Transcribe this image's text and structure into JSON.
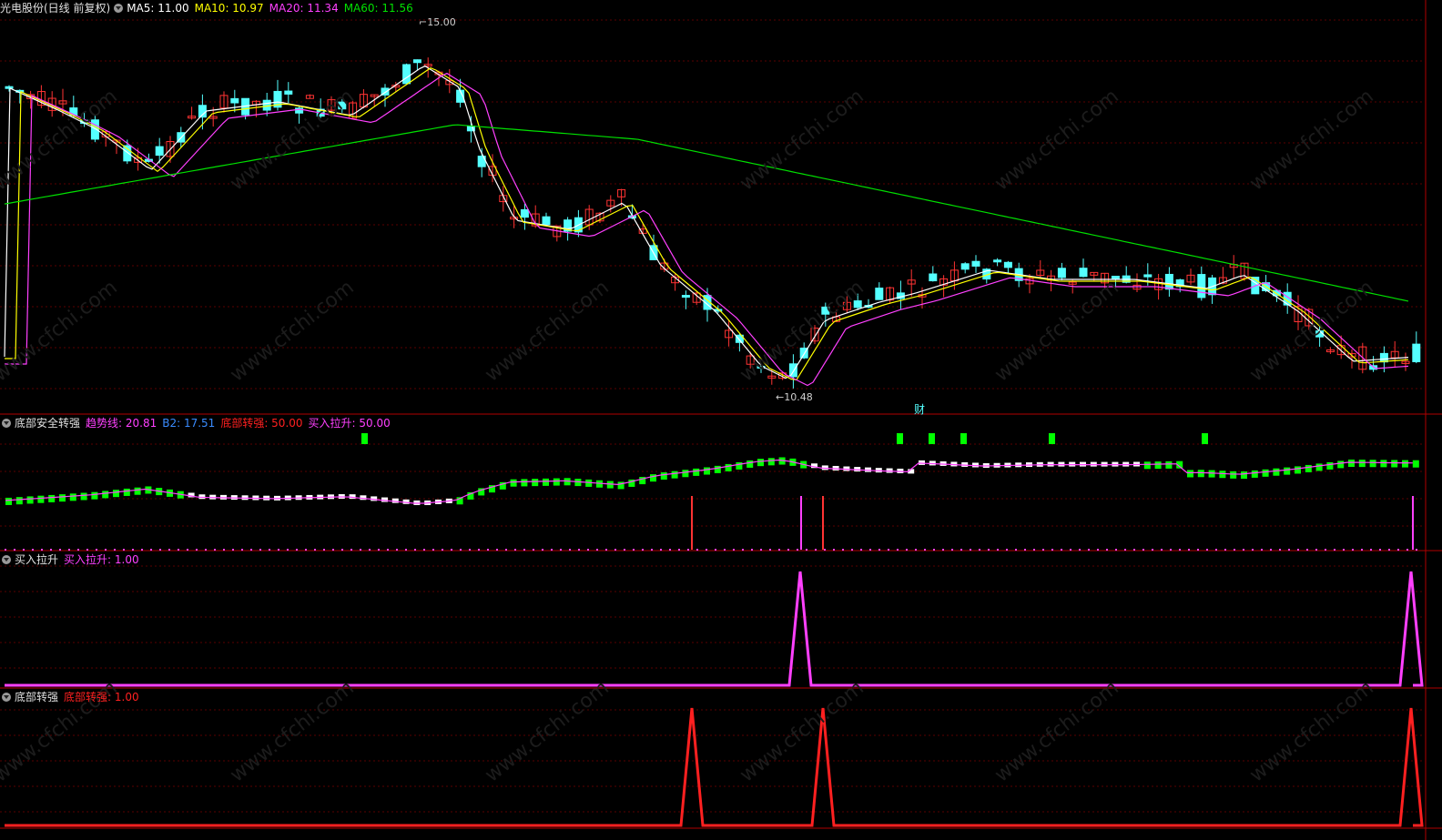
{
  "main": {
    "title": "光电股份(日线 前复权)",
    "indicators": [
      {
        "label": "MA5: 11.00",
        "color": "#ffffff"
      },
      {
        "label": "MA10: 10.97",
        "color": "#ffff00"
      },
      {
        "label": "MA20: 11.34",
        "color": "#ff40ff"
      },
      {
        "label": "MA60: 11.56",
        "color": "#00e000"
      }
    ],
    "high_label": "15.00",
    "low_label": "10.48",
    "cai_marker": "财"
  },
  "panel1": {
    "title": "底部安全转强",
    "indicators": [
      {
        "label": "趋势线: 20.81",
        "color": "#ff40ff"
      },
      {
        "label": "B2: 17.51",
        "color": "#3a8cff"
      },
      {
        "label": "底部转强: 50.00",
        "color": "#ff2020"
      },
      {
        "label": "买入拉升: 50.00",
        "color": "#ff40ff"
      }
    ]
  },
  "panel2": {
    "title": "买入拉升",
    "indicators": [
      {
        "label": "买入拉升: 1.00",
        "color": "#ff40ff"
      }
    ]
  },
  "panel3": {
    "title": "底部转强",
    "indicators": [
      {
        "label": "底部转强: 1.00",
        "color": "#ff2020"
      }
    ]
  },
  "watermark": "www.cfchi.com",
  "colors": {
    "up": "#ff3333",
    "down": "#54ffff",
    "ma5": "#ffffff",
    "ma10": "#ffff00",
    "ma20": "#ff40ff",
    "ma60": "#00e000"
  }
}
